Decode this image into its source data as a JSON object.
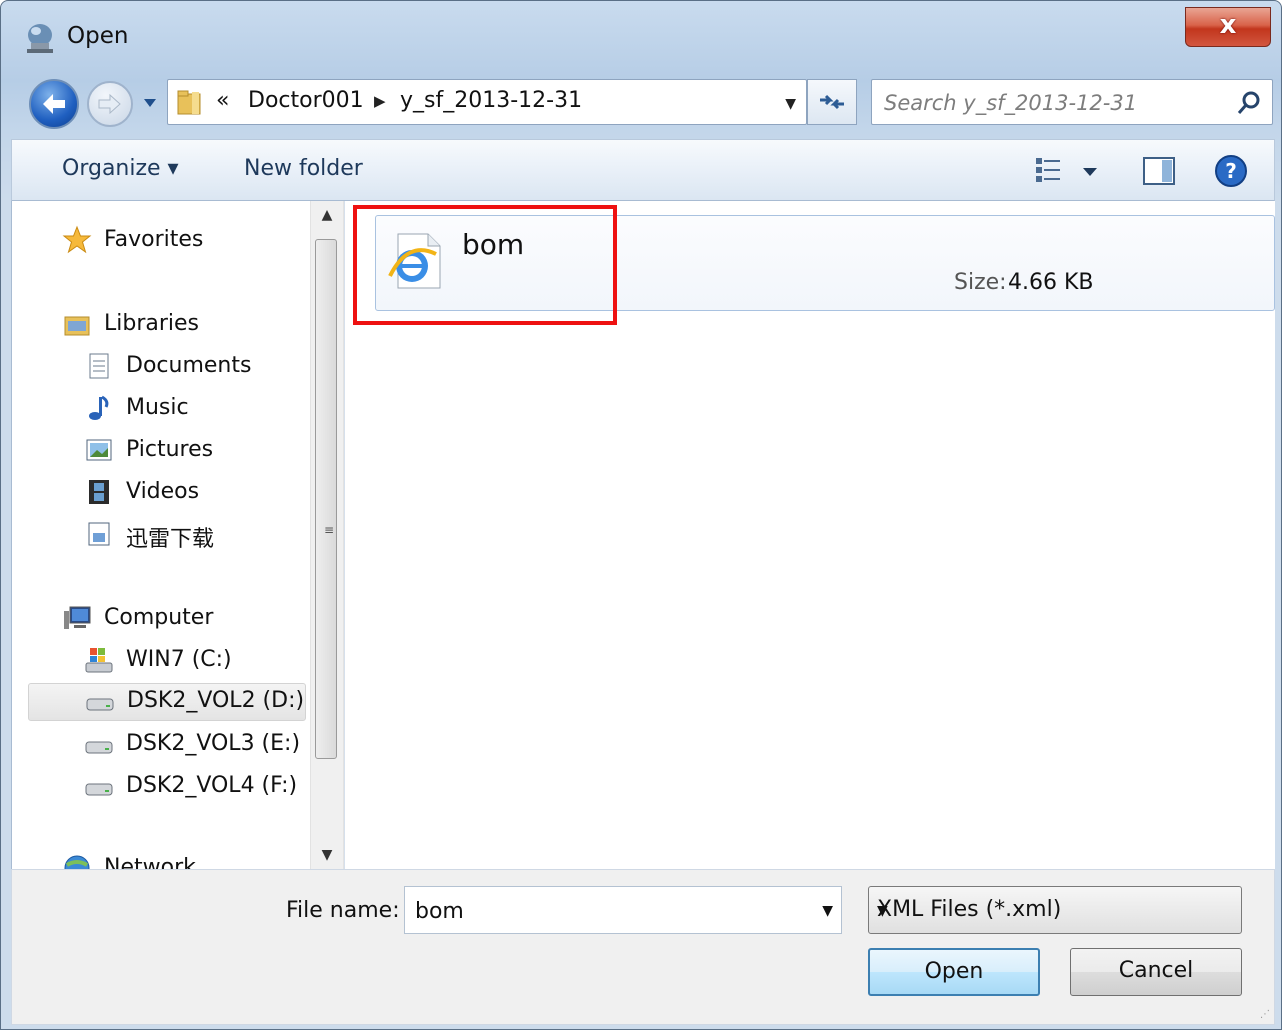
{
  "window": {
    "title": "Open",
    "close_label": "x"
  },
  "address": {
    "root_marker": "«",
    "crumbs": [
      "Doctor001",
      "y_sf_2013-12-31"
    ]
  },
  "search": {
    "placeholder": "Search y_sf_2013-12-31"
  },
  "toolbar": {
    "organize_label": "Organize ▾",
    "new_folder_label": "New folder"
  },
  "nav": {
    "favorites": "Favorites",
    "libraries": "Libraries",
    "documents": "Documents",
    "music": "Music",
    "pictures": "Pictures",
    "videos": "Videos",
    "xunlei": "迅雷下载",
    "computer": "Computer",
    "drive_c": "WIN7 (C:)",
    "drive_d": "DSK2_VOL2 (D:)",
    "drive_e": "DSK2_VOL3 (E:)",
    "drive_f": "DSK2_VOL4 (F:)",
    "network": "Network"
  },
  "files": [
    {
      "name": "bom",
      "size_label": "Size:",
      "size_value": "4.66 KB"
    }
  ],
  "footer": {
    "file_name_label": "File name:",
    "file_name_value": "bom",
    "filter_value": "XML Files (*.xml)",
    "open_label": "Open",
    "cancel_label": "Cancel"
  },
  "colors": {
    "highlight": "#ee1111",
    "accent": "#3c7fb1",
    "toolbar_text": "#1e395b"
  }
}
